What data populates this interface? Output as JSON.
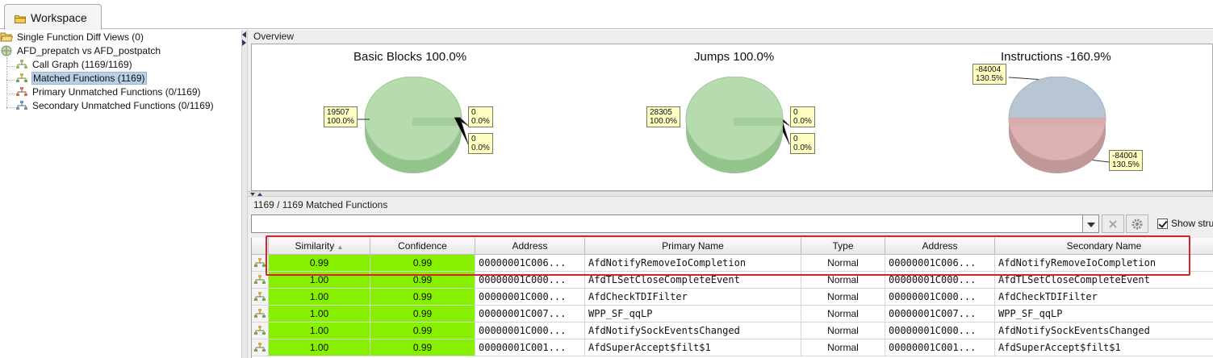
{
  "workspace_tab": {
    "label": "Workspace"
  },
  "tree": {
    "items": [
      {
        "label": "Single Function Diff Views (0)"
      },
      {
        "label": "AFD_prepatch vs AFD_postpatch"
      },
      {
        "label": "Call Graph (1169/1169)"
      },
      {
        "label": "Matched Functions (1169)"
      },
      {
        "label": "Primary Unmatched Functions (0/1169)"
      },
      {
        "label": "Secondary Unmatched Functions (0/1169)"
      }
    ]
  },
  "overview": {
    "title": "Overview",
    "charts": [
      {
        "title": "Basic Blocks 100.0%",
        "left_note": [
          "19507",
          "100.0%"
        ],
        "right_notes": [
          [
            "0",
            "0.0%"
          ],
          [
            "0",
            "0.0%"
          ]
        ]
      },
      {
        "title": "Jumps 100.0%",
        "left_note": [
          "28305",
          "100.0%"
        ],
        "right_notes": [
          [
            "0",
            "0.0%"
          ],
          [
            "0",
            "0.0%"
          ]
        ]
      },
      {
        "title": "Instructions -160.9%",
        "top_note": [
          "-84004",
          "130.5%"
        ],
        "bottom_note": [
          "-84004",
          "130.5%"
        ]
      }
    ]
  },
  "matched": {
    "title": "1169 / 1169 Matched Functions",
    "filter_placeholder": "",
    "show_structure_label": "Show stru",
    "columns": [
      "Similarity",
      "Confidence",
      "Address",
      "Primary Name",
      "Type",
      "Address",
      "Secondary Name"
    ],
    "rows": [
      {
        "similarity": "0.99",
        "confidence": "0.99",
        "primary_address": "00000001C006...",
        "primary_name": "AfdNotifyRemoveIoCompletion",
        "type": "Normal",
        "secondary_address": "00000001C006...",
        "secondary_name": "AfdNotifyRemoveIoCompletion"
      },
      {
        "similarity": "1.00",
        "confidence": "0.99",
        "primary_address": "00000001C000...",
        "primary_name": "AfdTLSetCloseCompleteEvent",
        "type": "Normal",
        "secondary_address": "00000001C000...",
        "secondary_name": "AfdTLSetCloseCompleteEvent"
      },
      {
        "similarity": "1.00",
        "confidence": "0.99",
        "primary_address": "00000001C000...",
        "primary_name": "AfdCheckTDIFilter",
        "type": "Normal",
        "secondary_address": "00000001C000...",
        "secondary_name": "AfdCheckTDIFilter"
      },
      {
        "similarity": "1.00",
        "confidence": "0.99",
        "primary_address": "00000001C007...",
        "primary_name": "WPP_SF_qqLP",
        "type": "Normal",
        "secondary_address": "00000001C007...",
        "secondary_name": "WPP_SF_qqLP"
      },
      {
        "similarity": "1.00",
        "confidence": "0.99",
        "primary_address": "00000001C000...",
        "primary_name": "AfdNotifySockEventsChanged",
        "type": "Normal",
        "secondary_address": "00000001C000...",
        "secondary_name": "AfdNotifySockEventsChanged"
      },
      {
        "similarity": "1.00",
        "confidence": "0.99",
        "primary_address": "00000001C001...",
        "primary_name": "AfdSuperAccept$filt$1",
        "type": "Normal",
        "secondary_address": "00000001C001...",
        "secondary_name": "AfdSuperAccept$filt$1"
      }
    ]
  },
  "colors": {
    "similarity_green": "#86f000",
    "pie_green": "#a8d4a0",
    "pie_blue": "#aab9c9",
    "pie_red": "#d3a6a6",
    "note_yellow": "#ffffc4",
    "highlight_red": "#d3232c"
  }
}
